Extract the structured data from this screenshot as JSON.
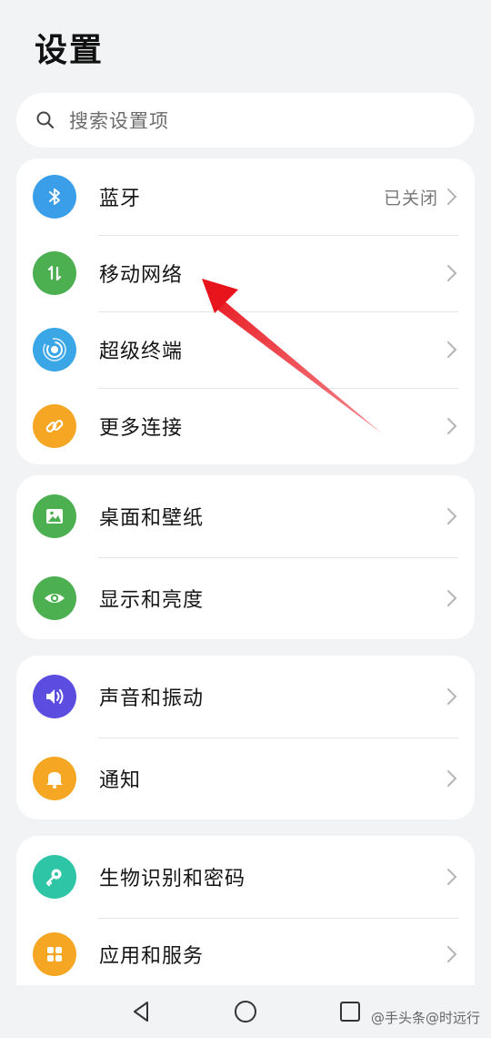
{
  "header": {
    "title": "设置"
  },
  "search": {
    "placeholder": "搜索设置项"
  },
  "groups": [
    {
      "items": [
        {
          "label": "蓝牙",
          "status": "已关闭",
          "icon": "bluetooth-icon",
          "color": "#3a9ee8"
        },
        {
          "label": "移动网络",
          "icon": "mobile-data-icon",
          "color": "#4caf50"
        },
        {
          "label": "超级终端",
          "icon": "super-device-icon",
          "color": "#3aa6e6"
        },
        {
          "label": "更多连接",
          "icon": "link-icon",
          "color": "#f5a623"
        }
      ]
    },
    {
      "items": [
        {
          "label": "桌面和壁纸",
          "icon": "wallpaper-icon",
          "color": "#4caf50"
        },
        {
          "label": "显示和亮度",
          "icon": "eye-icon",
          "color": "#4caf50"
        }
      ]
    },
    {
      "items": [
        {
          "label": "声音和振动",
          "icon": "speaker-icon",
          "color": "#5b4de0"
        },
        {
          "label": "通知",
          "icon": "bell-icon",
          "color": "#f5a623"
        }
      ]
    },
    {
      "items": [
        {
          "label": "生物识别和密码",
          "icon": "key-icon",
          "color": "#2ec4a6"
        },
        {
          "label": "应用和服务",
          "icon": "apps-icon",
          "color": "#f5a623"
        }
      ]
    }
  ],
  "annotation": {
    "arrow_color": "#e8141c"
  },
  "navbar": {
    "buttons": [
      "back-icon",
      "home-icon",
      "recents-icon"
    ]
  },
  "watermark": "@手头条@时远行"
}
